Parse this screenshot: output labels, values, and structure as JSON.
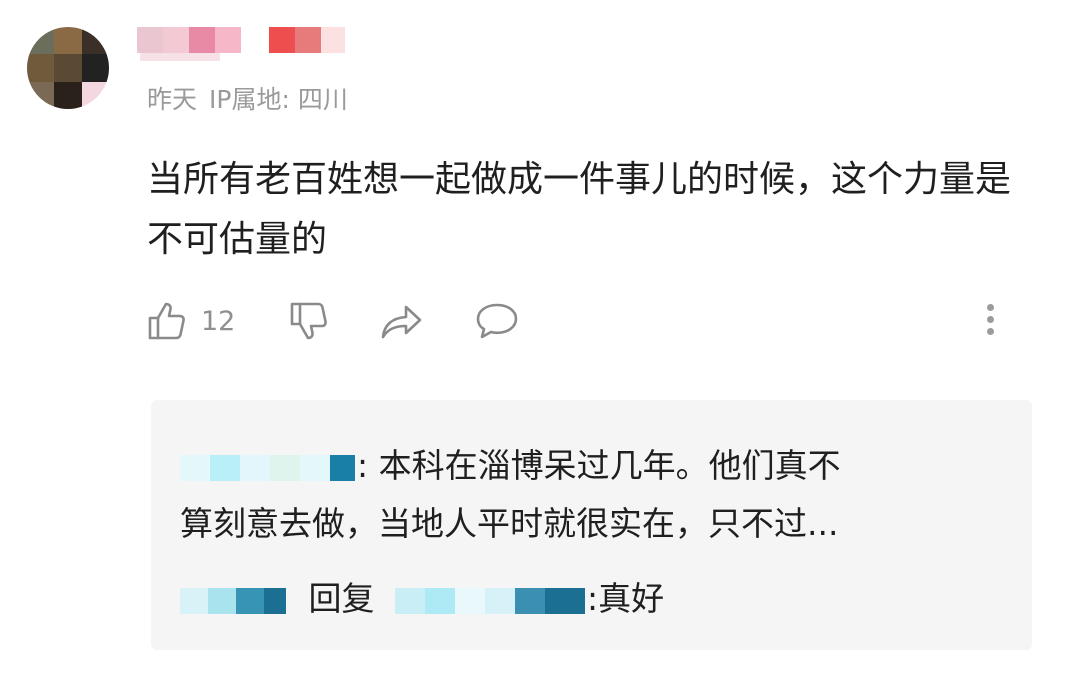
{
  "comment": {
    "time": "昨天",
    "ip_location": "IP属地: 四川",
    "text": "当所有老百姓想一起做成一件事儿的时候，这个力量是不可估量的",
    "like_count": "12"
  },
  "reply_preview": {
    "first_reply_text": ": 本科在淄博呆过几年。他们真不",
    "first_reply_text_2": "算刻意去做，当地人平时就很实在，只不过...",
    "second_reply_verb": "回复",
    "second_reply_text": ":真好"
  },
  "icons": {
    "like": "thumbs-up-icon",
    "dislike": "thumbs-down-icon",
    "share": "share-icon",
    "comment": "comment-bubble-icon",
    "more": "more-vertical-icon"
  },
  "colors": {
    "meta_text": "#9a9a9a",
    "icon_stroke": "#8a8a8a",
    "reply_bg": "#f5f5f5"
  }
}
